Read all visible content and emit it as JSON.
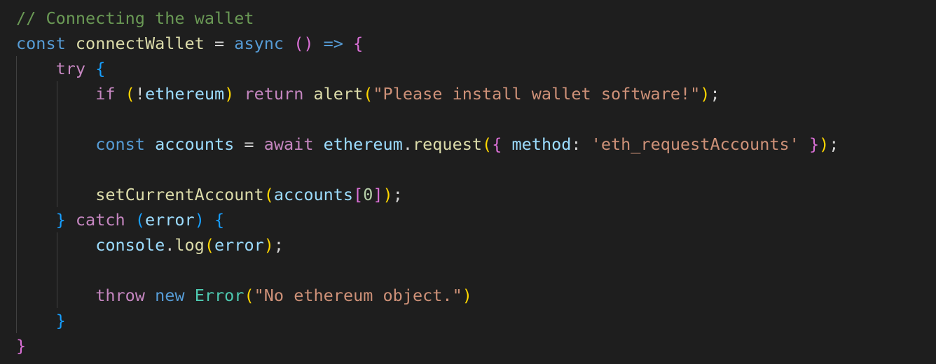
{
  "editor": {
    "background": "#1e1e1e",
    "colors": {
      "comment": "#6a9955",
      "storage": "#569cd6",
      "keyword": "#c586c0",
      "function": "#dcdcaa",
      "variable": "#9cdcfe",
      "string": "#ce9178",
      "number": "#b5cea8",
      "class": "#4ec9b0",
      "plain": "#d4d4d4",
      "bracket_level_1": "#ffd700",
      "bracket_level_2": "#da70d6",
      "bracket_level_3": "#179fff",
      "indent_guide": "#404040"
    },
    "lines": [
      [
        {
          "t": "// Connecting the wallet",
          "k": "comment"
        }
      ],
      [
        {
          "t": "const",
          "k": "storage"
        },
        {
          "t": " ",
          "k": "plain"
        },
        {
          "t": "connectWallet",
          "k": "function"
        },
        {
          "t": " = ",
          "k": "plain"
        },
        {
          "t": "async",
          "k": "storage"
        },
        {
          "t": " ",
          "k": "plain"
        },
        {
          "t": "()",
          "k": "bracket-2"
        },
        {
          "t": " ",
          "k": "plain"
        },
        {
          "t": "=>",
          "k": "storage"
        },
        {
          "t": " ",
          "k": "plain"
        },
        {
          "t": "{",
          "k": "bracket-2"
        }
      ],
      [
        {
          "t": "    ",
          "k": "plain"
        },
        {
          "t": "try",
          "k": "keyword"
        },
        {
          "t": " ",
          "k": "plain"
        },
        {
          "t": "{",
          "k": "bracket-3"
        }
      ],
      [
        {
          "t": "        ",
          "k": "plain"
        },
        {
          "t": "if",
          "k": "keyword"
        },
        {
          "t": " ",
          "k": "plain"
        },
        {
          "t": "(",
          "k": "bracket-1"
        },
        {
          "t": "!",
          "k": "plain"
        },
        {
          "t": "ethereum",
          "k": "variable"
        },
        {
          "t": ")",
          "k": "bracket-1"
        },
        {
          "t": " ",
          "k": "plain"
        },
        {
          "t": "return",
          "k": "keyword"
        },
        {
          "t": " ",
          "k": "plain"
        },
        {
          "t": "alert",
          "k": "function"
        },
        {
          "t": "(",
          "k": "bracket-1"
        },
        {
          "t": "\"Please install wallet software!\"",
          "k": "string"
        },
        {
          "t": ")",
          "k": "bracket-1"
        },
        {
          "t": ";",
          "k": "plain"
        }
      ],
      [],
      [
        {
          "t": "        ",
          "k": "plain"
        },
        {
          "t": "const",
          "k": "storage"
        },
        {
          "t": " ",
          "k": "plain"
        },
        {
          "t": "accounts",
          "k": "variable"
        },
        {
          "t": " = ",
          "k": "plain"
        },
        {
          "t": "await",
          "k": "keyword"
        },
        {
          "t": " ",
          "k": "plain"
        },
        {
          "t": "ethereum",
          "k": "variable"
        },
        {
          "t": ".",
          "k": "plain"
        },
        {
          "t": "request",
          "k": "function"
        },
        {
          "t": "(",
          "k": "bracket-1"
        },
        {
          "t": "{",
          "k": "bracket-2"
        },
        {
          "t": " ",
          "k": "plain"
        },
        {
          "t": "method",
          "k": "variable"
        },
        {
          "t": ": ",
          "k": "plain"
        },
        {
          "t": "'eth_requestAccounts'",
          "k": "string"
        },
        {
          "t": " ",
          "k": "plain"
        },
        {
          "t": "}",
          "k": "bracket-2"
        },
        {
          "t": ")",
          "k": "bracket-1"
        },
        {
          "t": ";",
          "k": "plain"
        }
      ],
      [],
      [
        {
          "t": "        ",
          "k": "plain"
        },
        {
          "t": "setCurrentAccount",
          "k": "function"
        },
        {
          "t": "(",
          "k": "bracket-1"
        },
        {
          "t": "accounts",
          "k": "variable"
        },
        {
          "t": "[",
          "k": "bracket-2"
        },
        {
          "t": "0",
          "k": "number"
        },
        {
          "t": "]",
          "k": "bracket-2"
        },
        {
          "t": ")",
          "k": "bracket-1"
        },
        {
          "t": ";",
          "k": "plain"
        }
      ],
      [
        {
          "t": "    ",
          "k": "plain"
        },
        {
          "t": "}",
          "k": "bracket-3"
        },
        {
          "t": " ",
          "k": "plain"
        },
        {
          "t": "catch",
          "k": "keyword"
        },
        {
          "t": " ",
          "k": "plain"
        },
        {
          "t": "(",
          "k": "bracket-3"
        },
        {
          "t": "error",
          "k": "variable"
        },
        {
          "t": ")",
          "k": "bracket-3"
        },
        {
          "t": " ",
          "k": "plain"
        },
        {
          "t": "{",
          "k": "bracket-3"
        }
      ],
      [
        {
          "t": "        ",
          "k": "plain"
        },
        {
          "t": "console",
          "k": "variable"
        },
        {
          "t": ".",
          "k": "plain"
        },
        {
          "t": "log",
          "k": "function"
        },
        {
          "t": "(",
          "k": "bracket-1"
        },
        {
          "t": "error",
          "k": "variable"
        },
        {
          "t": ")",
          "k": "bracket-1"
        },
        {
          "t": ";",
          "k": "plain"
        }
      ],
      [],
      [
        {
          "t": "        ",
          "k": "plain"
        },
        {
          "t": "throw",
          "k": "keyword"
        },
        {
          "t": " ",
          "k": "plain"
        },
        {
          "t": "new",
          "k": "storage"
        },
        {
          "t": " ",
          "k": "plain"
        },
        {
          "t": "Error",
          "k": "class"
        },
        {
          "t": "(",
          "k": "bracket-1"
        },
        {
          "t": "\"No ethereum object.\"",
          "k": "string"
        },
        {
          "t": ")",
          "k": "bracket-1"
        }
      ],
      [
        {
          "t": "    ",
          "k": "plain"
        },
        {
          "t": "}",
          "k": "bracket-3"
        }
      ],
      [
        {
          "t": "}",
          "k": "bracket-2"
        }
      ]
    ]
  }
}
